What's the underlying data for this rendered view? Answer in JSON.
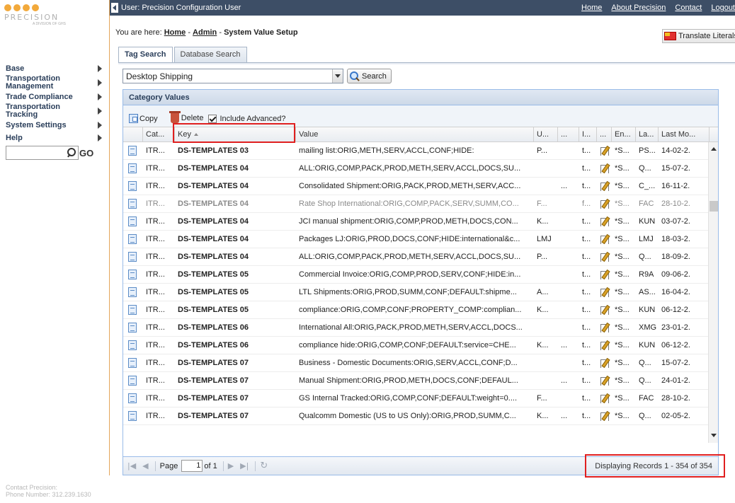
{
  "sidebar": {
    "logo_text": "PRECISION",
    "logo_sub": "A DIVISION OF GHS",
    "items": [
      {
        "label": "Base"
      },
      {
        "label": "Transportation Management"
      },
      {
        "label": "Trade Compliance"
      },
      {
        "label": "Transportation Tracking"
      },
      {
        "label": "System Settings"
      },
      {
        "label": "Help"
      }
    ],
    "go_label": "GO",
    "contact_title": "Contact Precision:",
    "contact_phone": "Phone Number: 312.239.1630"
  },
  "header": {
    "user": "User: Precision Configuration User",
    "links": [
      "Home",
      "About Precision",
      "Contact",
      "Logout"
    ]
  },
  "breadcrumb": {
    "prefix": "You are here: ",
    "home": "Home",
    "sep1": " - ",
    "admin": "Admin",
    "sep2": " - ",
    "current": "System Value Setup"
  },
  "translate_label": "Translate Literals",
  "tabs": [
    {
      "label": "Tag Search",
      "active": true
    },
    {
      "label": "Database Search",
      "active": false
    }
  ],
  "filter": {
    "selected": "Desktop Shipping",
    "search_label": "Search"
  },
  "panel": {
    "title": "Category Values",
    "toolbar": {
      "copy": "Copy",
      "delete": "Delete",
      "include_advanced": "Include Advanced?"
    },
    "columns": [
      "",
      "Cat...",
      "Key",
      "Value",
      "U...",
      "...",
      "I...",
      "...",
      "En...",
      "La...",
      "Last Mo..."
    ],
    "rows": [
      {
        "cat": "ITR...",
        "key": "DS-TEMPLATES 03",
        "value": "mailing list:ORIG,METH,SERV,ACCL,CONF;HIDE:",
        "u": "P...",
        "d1": "",
        "i": "t...",
        "en": "*S...",
        "la": "PS...",
        "last": "14-02-2.",
        "gray": false
      },
      {
        "cat": "ITR...",
        "key": "DS-TEMPLATES 04",
        "value": "ALL:ORIG,COMP,PACK,PROD,METH,SERV,ACCL,DOCS,SU...",
        "u": "",
        "d1": "",
        "i": "t...",
        "en": "*S...",
        "la": "Q...",
        "last": "15-07-2.",
        "gray": false
      },
      {
        "cat": "ITR...",
        "key": "DS-TEMPLATES 04",
        "value": "Consolidated Shipment:ORIG,PACK,PROD,METH,SERV,ACC...",
        "u": "",
        "d1": "...",
        "i": "t...",
        "en": "*S...",
        "la": "C_...",
        "last": "16-11-2.",
        "gray": false
      },
      {
        "cat": "ITR...",
        "key": "DS-TEMPLATES 04",
        "value": "Rate Shop International:ORIG,COMP,PACK,SERV,SUMM,CO...",
        "u": "F...",
        "d1": "",
        "i": "f...",
        "en": "*S...",
        "la": "FAC",
        "last": "28-10-2.",
        "gray": true
      },
      {
        "cat": "ITR...",
        "key": "DS-TEMPLATES 04",
        "value": "JCI manual shipment:ORIG,COMP,PROD,METH,DOCS,CON...",
        "u": "K...",
        "d1": "",
        "i": "t...",
        "en": "*S...",
        "la": "KUN",
        "last": "03-07-2.",
        "gray": false
      },
      {
        "cat": "ITR...",
        "key": "DS-TEMPLATES 04",
        "value": "Packages LJ:ORIG,PROD,DOCS,CONF;HIDE:international&c...",
        "u": "LMJ",
        "d1": "",
        "i": "t...",
        "en": "*S...",
        "la": "LMJ",
        "last": "18-03-2.",
        "gray": false
      },
      {
        "cat": "ITR...",
        "key": "DS-TEMPLATES 04",
        "value": "ALL:ORIG,COMP,PACK,PROD,METH,SERV,ACCL,DOCS,SU...",
        "u": "P...",
        "d1": "",
        "i": "t...",
        "en": "*S...",
        "la": "Q...",
        "last": "18-09-2.",
        "gray": false
      },
      {
        "cat": "ITR...",
        "key": "DS-TEMPLATES 05",
        "value": "Commercial Invoice:ORIG,COMP,PROD,SERV,CONF;HIDE:in...",
        "u": "",
        "d1": "",
        "i": "t...",
        "en": "*S...",
        "la": "R9A",
        "last": "09-06-2.",
        "gray": false
      },
      {
        "cat": "ITR...",
        "key": "DS-TEMPLATES 05",
        "value": "LTL Shipments:ORIG,PROD,SUMM,CONF;DEFAULT:shipme...",
        "u": "A...",
        "d1": "",
        "i": "t...",
        "en": "*S...",
        "la": "AS...",
        "last": "16-04-2.",
        "gray": false
      },
      {
        "cat": "ITR...",
        "key": "DS-TEMPLATES 05",
        "value": "compliance:ORIG,COMP,CONF;PROPERTY_COMP:complian...",
        "u": "K...",
        "d1": "",
        "i": "t...",
        "en": "*S...",
        "la": "KUN",
        "last": "06-12-2.",
        "gray": false
      },
      {
        "cat": "ITR...",
        "key": "DS-TEMPLATES 06",
        "value": "International All:ORIG,PACK,PROD,METH,SERV,ACCL,DOCS...",
        "u": "",
        "d1": "",
        "i": "t...",
        "en": "*S...",
        "la": "XMG",
        "last": "23-01-2.",
        "gray": false
      },
      {
        "cat": "ITR...",
        "key": "DS-TEMPLATES 06",
        "value": "compliance hide:ORIG,COMP,CONF;DEFAULT:service=CHE...",
        "u": "K...",
        "d1": "...",
        "i": "t...",
        "en": "*S...",
        "la": "KUN",
        "last": "06-12-2.",
        "gray": false
      },
      {
        "cat": "ITR...",
        "key": "DS-TEMPLATES 07",
        "value": "Business - Domestic Documents:ORIG,SERV,ACCL,CONF;D...",
        "u": "",
        "d1": "",
        "i": "t...",
        "en": "*S...",
        "la": "Q...",
        "last": "15-07-2.",
        "gray": false
      },
      {
        "cat": "ITR...",
        "key": "DS-TEMPLATES 07",
        "value": "Manual Shipment:ORIG,PROD,METH,DOCS,CONF;DEFAUL...",
        "u": "",
        "d1": "...",
        "i": "t...",
        "en": "*S...",
        "la": "Q...",
        "last": "24-01-2.",
        "gray": false
      },
      {
        "cat": "ITR...",
        "key": "DS-TEMPLATES 07",
        "value": "GS Internal Tracked:ORIG,COMP,CONF;DEFAULT:weight=0....",
        "u": "F...",
        "d1": "",
        "i": "t...",
        "en": "*S...",
        "la": "FAC",
        "last": "28-10-2.",
        "gray": false
      },
      {
        "cat": "ITR...",
        "key": "DS-TEMPLATES 07",
        "value": "Qualcomm Domestic (US to US Only):ORIG,PROD,SUMM,C...",
        "u": "K...",
        "d1": "...",
        "i": "t...",
        "en": "*S...",
        "la": "Q...",
        "last": "02-05-2.",
        "gray": false
      }
    ],
    "paging": {
      "page_label": "Page",
      "page_value": "1",
      "of_label": "of 1",
      "display": "Displaying Records 1 - 354 of 354"
    }
  }
}
